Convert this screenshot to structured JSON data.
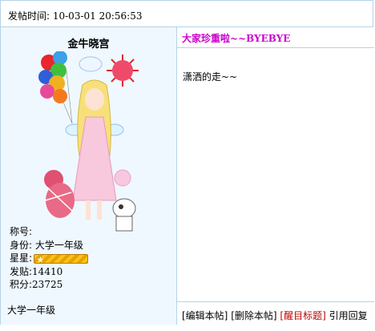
{
  "header": {
    "post_time_label": "发帖时间: ",
    "post_time": "10-03-01 20:56:53"
  },
  "user": {
    "name": "金牛晓宫",
    "title_label": "称号:",
    "identity": "身份: 大学一年级",
    "stars_label": "星星:",
    "posts_label": "发贴:",
    "posts": "14410",
    "points_label": "积分:",
    "points": "23725",
    "rank": "大学一年级"
  },
  "post": {
    "title": "大家珍重啦",
    "title_suffix": "~~BYEBYE",
    "body": "潇洒的走~~"
  },
  "actions": {
    "edit": "[编辑本帖]",
    "delete": "[删除本帖]",
    "highlight": "[醒目标题]",
    "quote": "引用回复"
  },
  "colors": {
    "border": "#b6d3e6",
    "left_bg": "#eff8ff",
    "title": "#cc00cc",
    "highlight": "#c00000"
  }
}
